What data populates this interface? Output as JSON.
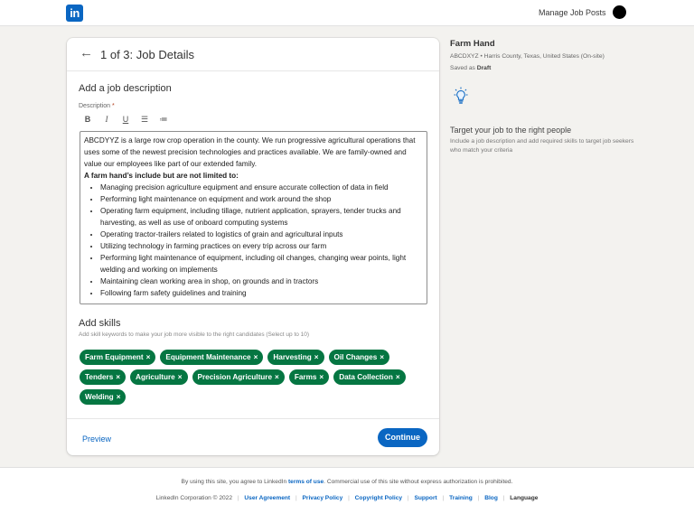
{
  "topbar": {
    "logo_text": "in",
    "manage_link": "Manage Job Posts"
  },
  "card": {
    "step_title": "1 of 3: Job Details",
    "section_title": "Add a job description",
    "description_label": "Description",
    "required_mark": "*",
    "toolbar": {
      "bold": "B",
      "italic": "I",
      "underline": "U",
      "bullets": "☰",
      "numbers": "≔"
    },
    "description": {
      "intro": "ABCDYYZ is a large row crop operation in the county. We run progressive agricultural operations that uses some of the newest precision technologies and practices available. We are family-owned and value our employees like part of our extended family.",
      "list_heading": "A farm hand’s include but are not limited to:",
      "items": [
        "Managing precision agriculture equipment and ensure accurate collection of data in field",
        "Performing light maintenance on equipment and work around the shop",
        "Operating farm equipment, including tillage, nutrient application, sprayers, tender trucks and harvesting, as well as use of onboard computing systems",
        "Operating tractor-trailers related to logistics of grain and agricultural inputs",
        "Utilizing  technology in farming practices on every trip across our farm",
        "Performing light maintenance of equipment, including oil changes, changing wear points, light welding and working on implements",
        "Maintaining clean working area in shop, on grounds and in tractors",
        "Following farm safety guidelines and training"
      ]
    },
    "skills_title": "Add skills",
    "skills_hint": "Add skill keywords to make your job more visible to the right candidates (Select up to 10)",
    "chip_remove": "×",
    "skills": [
      "Farm Equipment",
      "Equipment Maintenance",
      "Harvesting",
      "Oil Changes",
      "Tenders",
      "Agriculture",
      "Precision Agriculture",
      "Farms",
      "Data Collection",
      "Welding"
    ],
    "preview_label": "Preview",
    "continue_label": "Continue"
  },
  "sidebar": {
    "job_title": "Farm Hand",
    "company_location": "ABCDXYZ •  Harris County, Texas, United States (On-site)",
    "saved_prefix": "Saved as",
    "saved_status": "Draft",
    "target_title": "Target your job to the right people",
    "target_text": "Include a job description and add required skills to target job seekers who match your criteria"
  },
  "footer": {
    "terms_prefix": "By using this site, you agree to LinkedIn",
    "terms_link": "terms of use",
    "terms_suffix": ". Commercial use of this site without express authorization is prohibited.",
    "copyright": "LinkedIn Corporation © 2022",
    "links": [
      "User Agreement",
      "Privacy Policy",
      "Copyright Policy",
      "Support",
      "Training",
      "Blog"
    ],
    "language": "Language"
  },
  "colors": {
    "brand_blue": "#0a66c2",
    "chip_green": "#057642",
    "page_bg": "#f3f2ef"
  }
}
